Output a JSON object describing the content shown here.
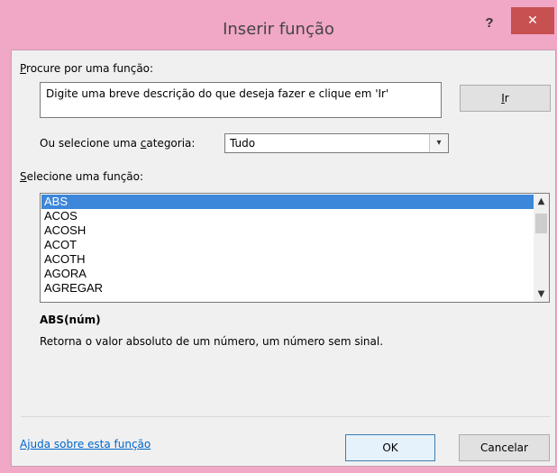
{
  "window": {
    "title": "Inserir função",
    "help_label": "?",
    "close_label": "✕"
  },
  "search": {
    "label_accel": "P",
    "label_rest": "rocure por uma função:",
    "value": "Digite uma breve descrição do que deseja fazer e clique em 'Ir'",
    "go_accel": "I",
    "go_rest": "r"
  },
  "category": {
    "label_prefix": "Ou selecione uma ",
    "label_accel": "c",
    "label_suffix": "ategoria:",
    "selected": "Tudo",
    "arrow": "▾"
  },
  "functions": {
    "label_accel": "S",
    "label_rest": "elecione uma função:",
    "items": [
      "ABS",
      "ACOS",
      "ACOSH",
      "ACOT",
      "ACOTH",
      "AGORA",
      "AGREGAR"
    ],
    "selected_index": 0,
    "scroll_up": "▲",
    "scroll_down": "▼"
  },
  "details": {
    "signature": "ABS(núm)",
    "description": "Retorna o valor absoluto de um número, um número sem sinal."
  },
  "footer": {
    "help_link": "Ajuda sobre esta função",
    "ok_label": "OK",
    "cancel_label": "Cancelar"
  },
  "colors": {
    "frame": "#f1a7c6",
    "close_button": "#c75050",
    "selection": "#3c87d9",
    "link": "#0066cc"
  }
}
